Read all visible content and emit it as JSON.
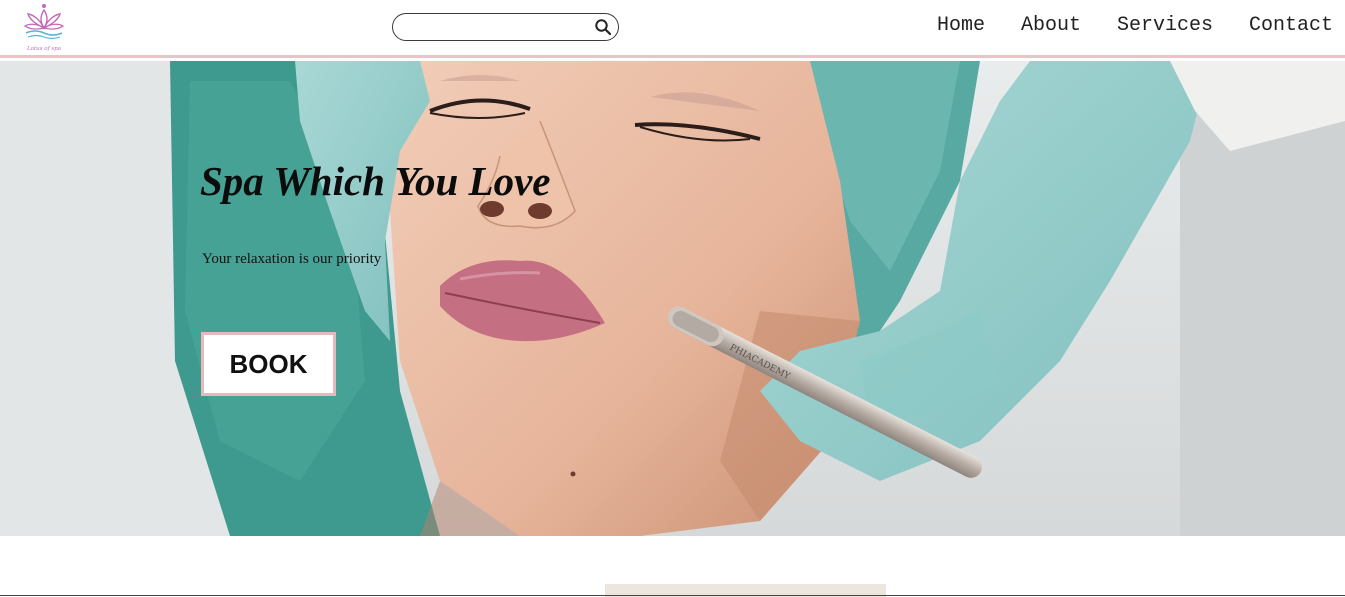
{
  "header": {
    "logo_icon": "lotus-logo-icon",
    "logo_tagline": "Lotus of spa",
    "search": {
      "placeholder": "",
      "value": "",
      "icon": "search-icon"
    },
    "nav": [
      {
        "label": "Home"
      },
      {
        "label": "About"
      },
      {
        "label": "Services"
      },
      {
        "label": "Contact"
      }
    ],
    "accent_color": "#e8c4c8"
  },
  "hero": {
    "title": "Spa Which You Love",
    "subtitle": "Your relaxation is our priority",
    "button_label": "BOOK",
    "tool_engraving": "PHIACADEMY"
  }
}
